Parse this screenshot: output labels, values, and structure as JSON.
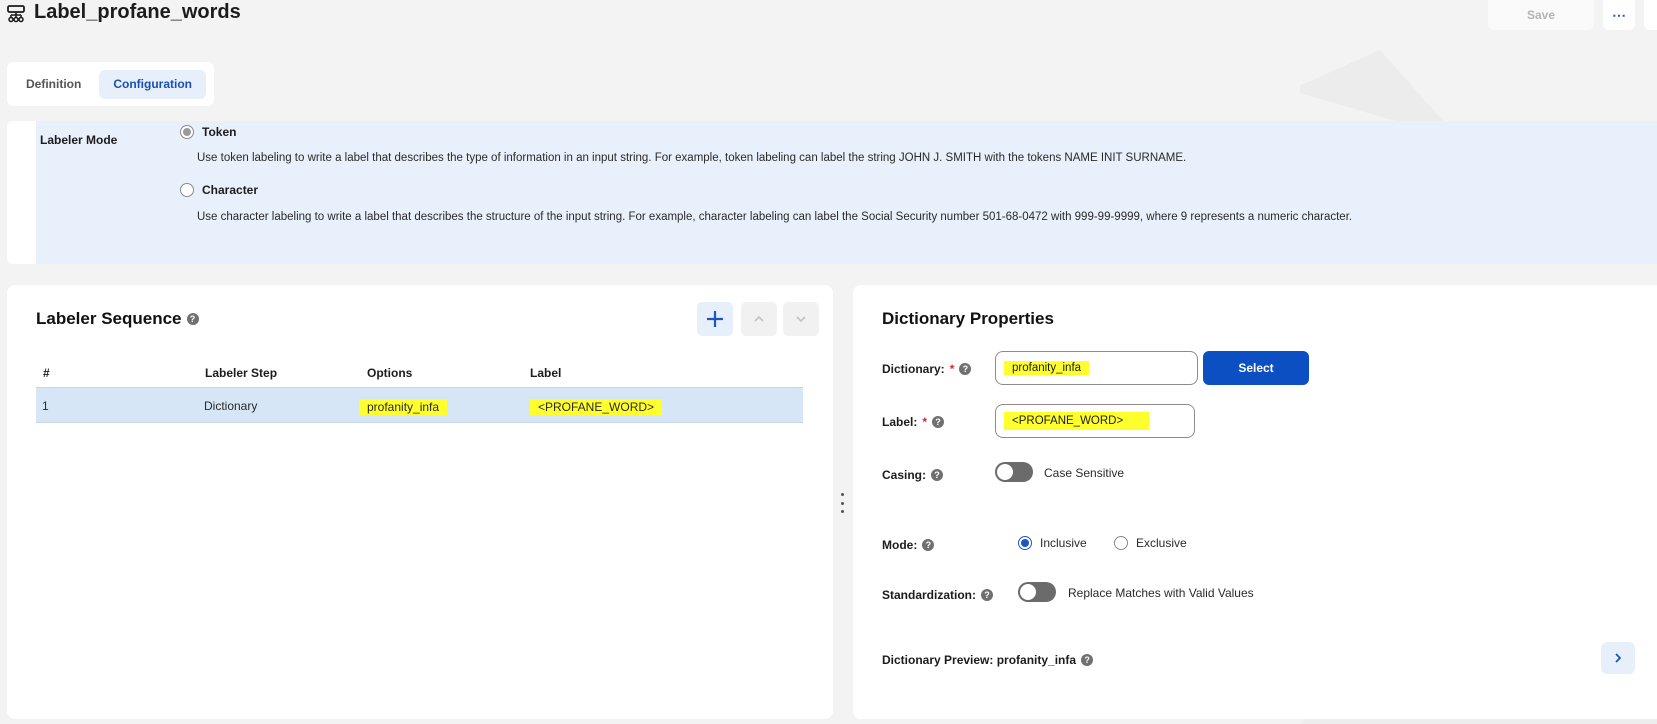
{
  "header": {
    "title": "Label_profane_words",
    "save_label": "Save",
    "more_label": "⋯"
  },
  "tabs": [
    {
      "label": "Definition",
      "active": false
    },
    {
      "label": "Configuration",
      "active": true
    }
  ],
  "labeler_mode": {
    "label": "Labeler Mode",
    "options": [
      {
        "label": "Token",
        "selected": true,
        "description": "Use token labeling to write a label that describes the type of information in an input string. For example, token labeling can label the string JOHN J. SMITH with the tokens NAME INIT SURNAME."
      },
      {
        "label": "Character",
        "selected": false,
        "description": "Use character labeling to write a label that describes the structure of the input string. For example, character labeling can label the Social Security number 501-68-0472 with 999-99-9999, where 9 represents a numeric character."
      }
    ]
  },
  "labeler_sequence": {
    "title": "Labeler Sequence",
    "columns": [
      "#",
      "Labeler Step",
      "Options",
      "Label"
    ],
    "rows": [
      {
        "num": "1",
        "step": "Dictionary",
        "options": "profanity_infa",
        "label": "<PROFANE_WORD>"
      }
    ]
  },
  "dictionary_properties": {
    "title": "Dictionary Properties",
    "dictionary_label": "Dictionary:",
    "dictionary_value": "profanity_infa",
    "select_label": "Select",
    "label_label": "Label:",
    "label_value": "<PROFANE_WORD>",
    "casing_label": "Casing:",
    "casing_toggle_label": "Case Sensitive",
    "casing_on": false,
    "mode_label": "Mode:",
    "mode_options": [
      "Inclusive",
      "Exclusive"
    ],
    "mode_selected": "Inclusive",
    "standardization_label": "Standardization:",
    "standardization_toggle_label": "Replace Matches with Valid Values",
    "standardization_on": false,
    "preview_label": "Dictionary Preview: profanity_infa",
    "required_mark": "*",
    "help_mark": "?"
  },
  "colors": {
    "accent": "#0b4fc2",
    "highlight": "#ffff2e",
    "panel_bg": "#e8f0fb",
    "row_selected": "#d6e6f7"
  }
}
